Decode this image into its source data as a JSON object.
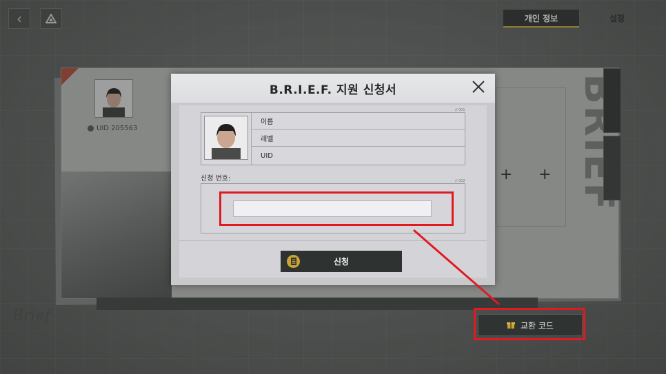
{
  "top_nav": {
    "back_icon": "chevron-left-icon",
    "home_icon": "triangle-logo-icon",
    "tabs": [
      {
        "label": "개인 정보",
        "active": true
      },
      {
        "label": "설정",
        "active": false
      }
    ]
  },
  "profile_card": {
    "uid_text": "UID 205563"
  },
  "exchange": {
    "button_label": "교환 코드",
    "icon": "gift-icon"
  },
  "signature": "Brief",
  "modal": {
    "title": "B.R.I.E.F. 지원 신청서",
    "close_icon": "close-icon",
    "info_rows": [
      "이름",
      "레벨",
      "UID"
    ],
    "apply_number_label": "신청 번호:",
    "code_input": {
      "value": "",
      "placeholder": ""
    },
    "submit_label": "신청",
    "micro_codes": [
      "// 001",
      "// 002"
    ]
  },
  "colors": {
    "highlight": "#e01a22",
    "accent_gold": "#c9a336",
    "dark_button": "#2e3332"
  }
}
